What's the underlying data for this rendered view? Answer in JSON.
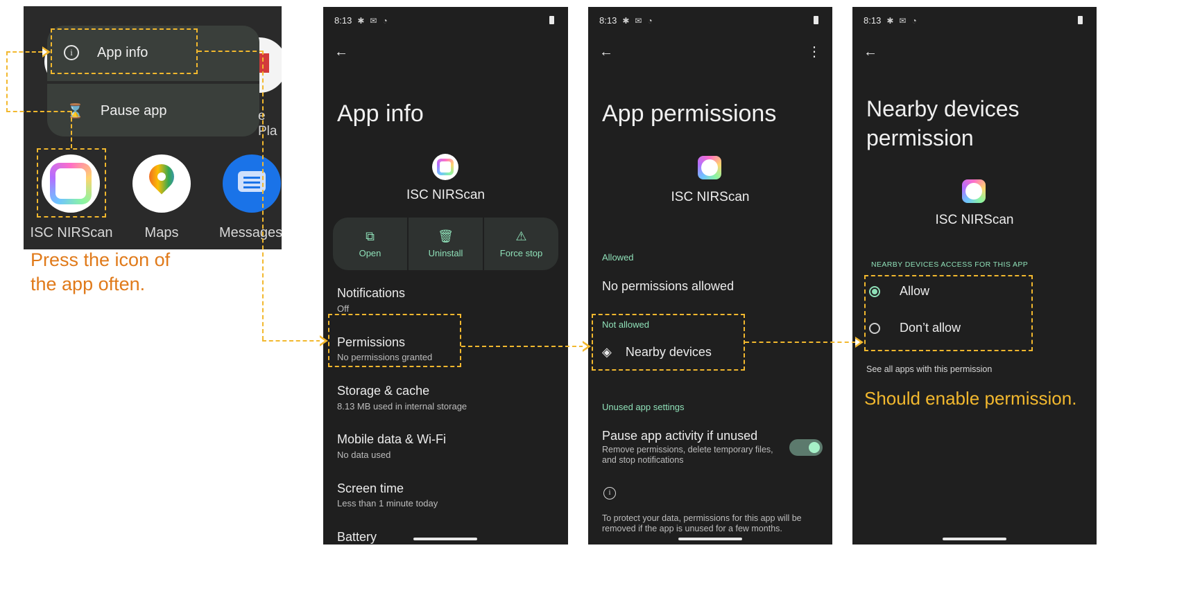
{
  "panel1": {
    "menu_app_info": "App info",
    "menu_pause_app": "Pause app",
    "partial_label": "e Pla",
    "apps": [
      {
        "label": "ISC NIRScan"
      },
      {
        "label": "Maps"
      },
      {
        "label": "Messages"
      }
    ],
    "instruction": "Press the icon of the app often."
  },
  "panel2": {
    "time": "8:13",
    "title": "App info",
    "app_name": "ISC NIRScan",
    "actions": [
      {
        "label": "Open",
        "icon": "open-external-icon"
      },
      {
        "label": "Uninstall",
        "icon": "trash-icon"
      },
      {
        "label": "Force stop",
        "icon": "warning-triangle-icon"
      }
    ],
    "items": [
      {
        "title": "Notifications",
        "sub": "Off"
      },
      {
        "title": "Permissions",
        "sub": "No permissions granted"
      },
      {
        "title": "Storage & cache",
        "sub": "8.13 MB used in internal storage"
      },
      {
        "title": "Mobile data & Wi-Fi",
        "sub": "No data used"
      },
      {
        "title": "Screen time",
        "sub": "Less than 1 minute today"
      },
      {
        "title": "Battery",
        "sub": ""
      }
    ]
  },
  "panel3": {
    "time": "8:13",
    "title": "App permissions",
    "app_name": "ISC NIRScan",
    "allowed_header": "Allowed",
    "allowed_empty": "No permissions allowed",
    "not_allowed_header": "Not allowed",
    "nearby_devices": "Nearby devices",
    "unused_header": "Unused app settings",
    "pause_title": "Pause app activity if unused",
    "pause_sub": "Remove permissions, delete temporary files, and stop notifications",
    "pause_toggle_on": true,
    "info_text": "To protect your data, permissions for this app will be removed if the app is unused for a few months."
  },
  "panel4": {
    "time": "8:13",
    "title": "Nearby devices permission",
    "app_name": "ISC NIRScan",
    "section": "NEARBY DEVICES ACCESS FOR THIS APP",
    "options": [
      {
        "label": "Allow",
        "selected": true
      },
      {
        "label": "Don’t allow",
        "selected": false
      }
    ],
    "see_all": "See all apps with this permission",
    "note": "Should enable permission."
  },
  "colors": {
    "annotation": "#f2b82e",
    "instruction_text": "#e07a1a",
    "note_text": "#f2b82e",
    "accent_green": "#8fe0b8",
    "phone_bg": "#1f1f1f"
  }
}
